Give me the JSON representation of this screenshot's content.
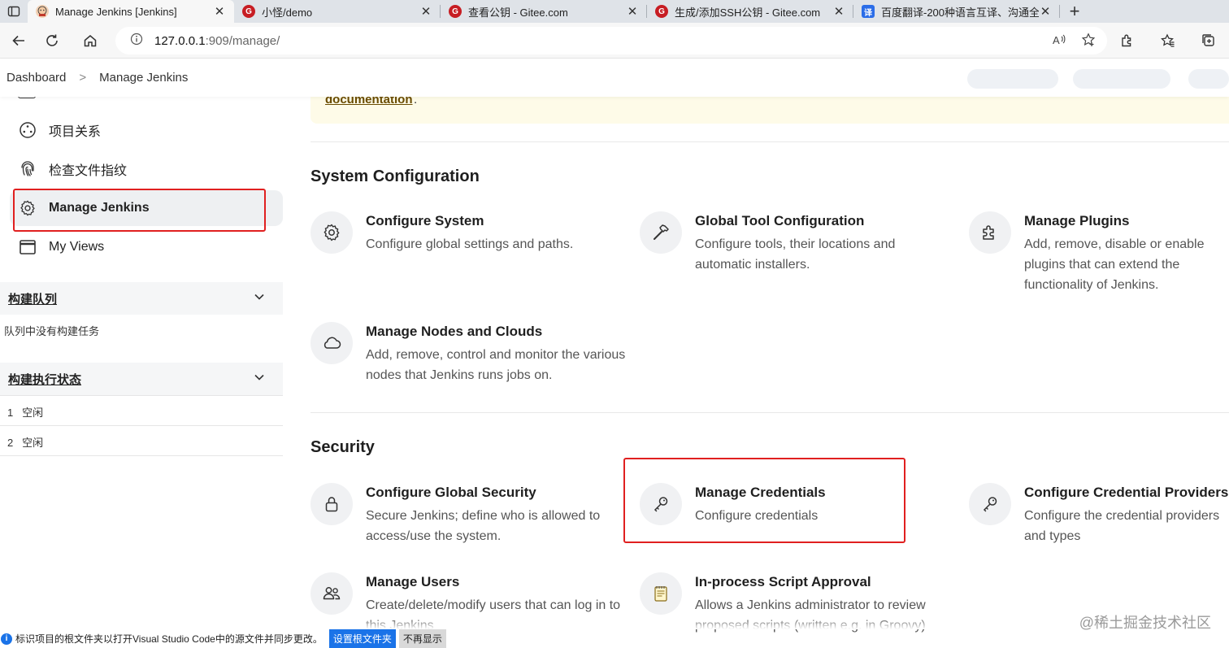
{
  "browser": {
    "tabs": [
      {
        "title": "Manage Jenkins [Jenkins]",
        "favicon": "jenkins-icon",
        "close": "✕"
      },
      {
        "title": "小怪/demo",
        "favicon": "gitee-icon",
        "close": "✕"
      },
      {
        "title": "查看公钥 - Gitee.com",
        "favicon": "gitee-icon",
        "close": "✕"
      },
      {
        "title": "生成/添加SSH公钥 - Gitee.com",
        "favicon": "gitee-icon",
        "close": "✕"
      },
      {
        "title": "百度翻译-200种语言互译、沟通全",
        "favicon": "baidu-translate-icon",
        "close": "✕"
      }
    ],
    "new_tab": "+",
    "url_host": "127.0.0.1",
    "url_path": ":909/manage/"
  },
  "breadcrumb": {
    "items": [
      "Dashboard",
      "Manage Jenkins"
    ],
    "separator": ">"
  },
  "sidebar": {
    "items": [
      {
        "label": "项目关系",
        "icon": "project-relationship-icon"
      },
      {
        "label": "检查文件指纹",
        "icon": "fingerprint-icon"
      },
      {
        "label": "Manage Jenkins",
        "icon": "gear-icon"
      },
      {
        "label": "My Views",
        "icon": "window-icon"
      }
    ],
    "build_queue": {
      "title": "构建队列",
      "text": "队列中没有构建任务"
    },
    "executors": {
      "title": "构建执行状态",
      "rows": [
        {
          "num": "1",
          "status": "空闲"
        },
        {
          "num": "2",
          "status": "空闲"
        }
      ]
    }
  },
  "notice": {
    "link": "documentation",
    "tail": "."
  },
  "sections": [
    {
      "title": "System Configuration",
      "cards": [
        {
          "title": "Configure System",
          "desc": "Configure global settings and paths.",
          "icon": "gear-icon"
        },
        {
          "title": "Global Tool Configuration",
          "desc": "Configure tools, their locations and automatic installers.",
          "icon": "hammer-icon"
        },
        {
          "title": "Manage Plugins",
          "desc": "Add, remove, disable or enable plugins that can extend the functionality of Jenkins.",
          "icon": "puzzle-icon"
        },
        {
          "title": "Manage Nodes and Clouds",
          "desc": "Add, remove, control and monitor the various nodes that Jenkins runs jobs on.",
          "icon": "cloud-icon"
        }
      ]
    },
    {
      "title": "Security",
      "cards": [
        {
          "title": "Configure Global Security",
          "desc": "Secure Jenkins; define who is allowed to access/use the system.",
          "icon": "lock-icon"
        },
        {
          "title": "Manage Credentials",
          "desc": "Configure credentials",
          "icon": "key-icon"
        },
        {
          "title": "Configure Credential Providers",
          "desc": "Configure the credential providers and types",
          "icon": "key-icon"
        },
        {
          "title": "Manage Users",
          "desc": "Create/delete/modify users that can log in to this Jenkins",
          "icon": "users-icon"
        },
        {
          "title": "In-process Script Approval",
          "desc": "Allows a Jenkins administrator to review proposed scripts (written e.g. in Groovy)",
          "icon": "notepad-icon"
        }
      ]
    }
  ],
  "infobar": {
    "icon": "i",
    "message": "标识项目的根文件夹以打开Visual Studio Code中的源文件并同步更改。",
    "primary": "设置根文件夹",
    "secondary": "不再显示"
  },
  "watermark": "@稀土掘金技术社区",
  "colors": {
    "highlight": "#e02020",
    "accent": "#1a73e8",
    "notice_bg": "#fefbe8"
  }
}
